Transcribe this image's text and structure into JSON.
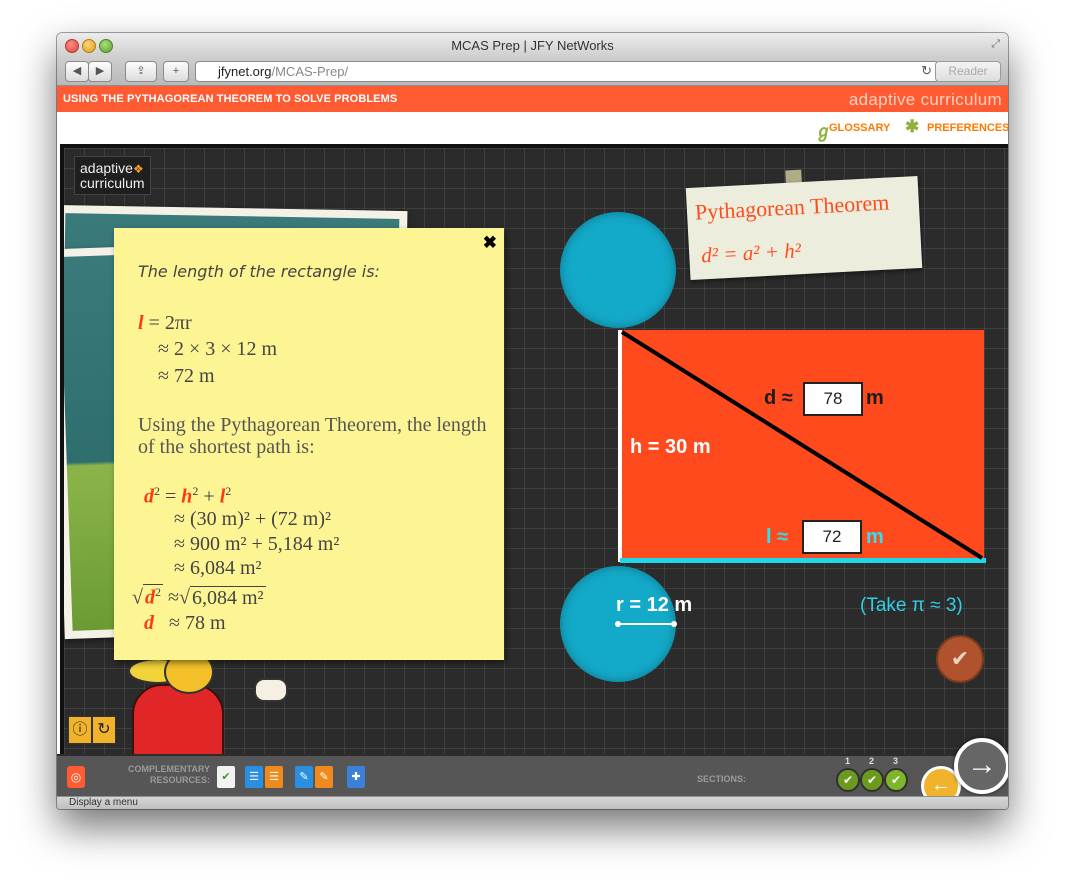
{
  "window": {
    "title": "MCAS Prep | JFY NetWorks",
    "url_host": "jfynet.org",
    "url_path": "/MCAS-Prep/",
    "reader_label": "Reader",
    "status_text": "Display a menu"
  },
  "header": {
    "lesson_title": "USING THE PYTHAGOREAN THEOREM TO SOLVE PROBLEMS",
    "brand": "adaptive curriculum",
    "glossary": "GLOSSARY",
    "preferences": "PREFERENCES"
  },
  "logo": {
    "line1": "adaptive",
    "line2": "curriculum"
  },
  "note": {
    "close": "✖",
    "intro": "The length of the rectangle is:",
    "l_var": "l",
    "l_eq1": "= 2πr",
    "l_eq2": "≈ 2 × 3 × 12 m",
    "l_eq3": "≈ 72 m",
    "paragraph": "Using the Pythagorean Theorem, the length of the shortest path is:",
    "d_var": "d",
    "h_var": "h",
    "step2": "≈ (30 m)² + (72 m)²",
    "step3": "≈ 900 m² + 5,184 m²",
    "step4": "≈ 6,084 m²",
    "sqrt_rhs": "6,084 m²",
    "final": "≈ 78 m"
  },
  "theorem_card": {
    "title": "Pythagorean Theorem",
    "formula": "d² = a² + h²"
  },
  "diagram": {
    "h_label": "h = 30 m",
    "d_prefix": "d ≈",
    "d_value": "78",
    "d_unit": "m",
    "l_prefix": "l ≈",
    "l_value": "72",
    "l_unit": "m",
    "r_label": "r = 12 m",
    "pi_note": "(Take  π ≈ 3)"
  },
  "bottom": {
    "comp_label": "COMPLEMENTARY RESOURCES:",
    "sections_label": "SECTIONS:",
    "sections": [
      "1",
      "2",
      "3"
    ]
  },
  "colors": {
    "accent": "#ff5b32",
    "cyan": "#13a9c8",
    "note": "#fdf594"
  }
}
